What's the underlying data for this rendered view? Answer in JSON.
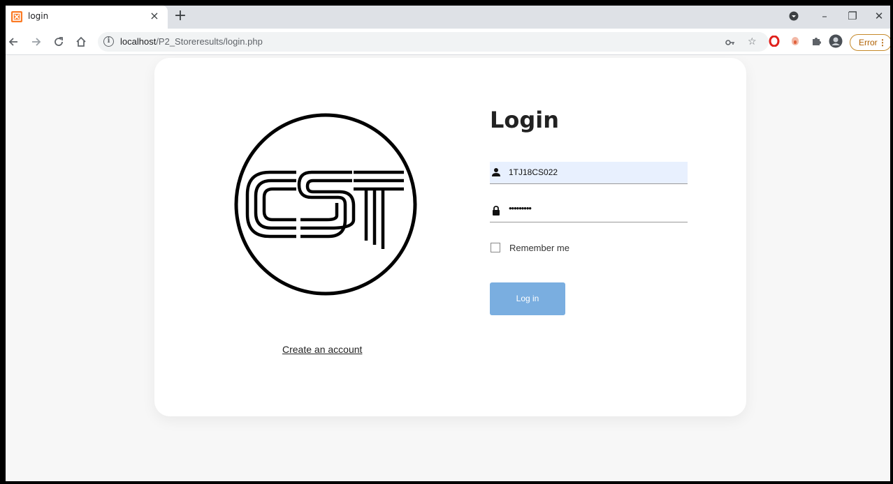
{
  "browser": {
    "tab": {
      "title": "login",
      "favicon": "xampp-icon",
      "close": "×"
    },
    "new_tab": "+",
    "window_controls": {
      "minimize": "–",
      "restore": "❐",
      "close": "✕"
    },
    "address": {
      "host": "localhost",
      "path": "/P2_Storeresults/login.php"
    },
    "error_label": "Error",
    "menu_dots": "⋮"
  },
  "page": {
    "title": "Login",
    "username_value": "1TJ18CS022",
    "password_mask": "•••••••••",
    "remember_label": "Remember me",
    "login_button": "Log in",
    "create_account_link": "Create an account",
    "accent_color": "#7aaee0"
  }
}
